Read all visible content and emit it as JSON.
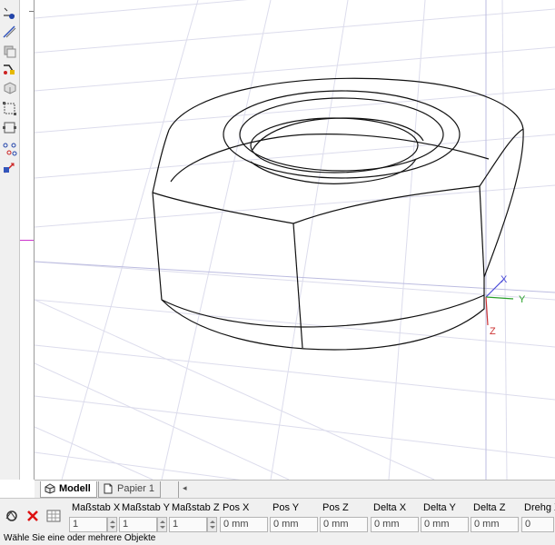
{
  "tabs": [
    {
      "label": "Modell",
      "active": true
    },
    {
      "label": "Papier 1",
      "active": false
    }
  ],
  "fields": [
    {
      "label": "Maßstab X",
      "value": "1"
    },
    {
      "label": "Maßstab Y",
      "value": "1"
    },
    {
      "label": "Maßstab Z",
      "value": "1"
    },
    {
      "label": "Pos X",
      "value": "0 mm"
    },
    {
      "label": "Pos Y",
      "value": "0 mm"
    },
    {
      "label": "Pos Z",
      "value": "0 mm"
    },
    {
      "label": "Delta X",
      "value": "0 mm"
    },
    {
      "label": "Delta Y",
      "value": "0 mm"
    },
    {
      "label": "Delta Z",
      "value": "0 mm"
    },
    {
      "label": "Drehg X",
      "value": "0"
    }
  ],
  "axes": {
    "x": "X",
    "y": "Y",
    "z": "Z"
  },
  "axis_colors": {
    "x": "#4a4ad8",
    "y": "#2aa02a",
    "z": "#cc3333"
  },
  "status": {
    "text": "Wähle Sie eine oder mehrere Objekte"
  },
  "icons": {
    "left_toolbar": [
      "draw-line-icon",
      "dimension-icon",
      "layer-icon",
      "paint-icon",
      "solid-icon",
      "scale-icon",
      "frame-icon",
      "snap-points-icon",
      "transform-icon"
    ],
    "propbar": [
      "tool-icon",
      "delete-icon",
      "grid-icon"
    ]
  }
}
